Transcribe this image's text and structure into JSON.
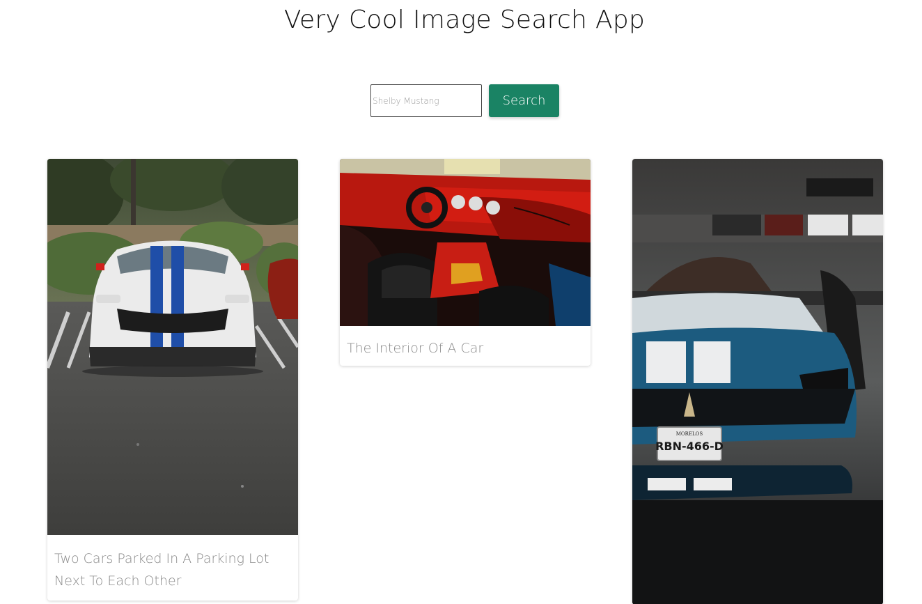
{
  "header": {
    "title": "Very Cool Image Search App"
  },
  "search": {
    "placeholder": "Shelby Mustang",
    "value": "",
    "button_label": "Search"
  },
  "results": [
    {
      "caption": "Two Cars Parked In A Parking Lot Next To Each Other",
      "plate": ""
    },
    {
      "caption": "The Interior Of A Car",
      "plate": ""
    },
    {
      "caption": "",
      "plate": "RBN-466-D",
      "plate_top": "MORELOS"
    }
  ],
  "colors": {
    "accent": "#1a8364",
    "caption_text": "#8a8a8a",
    "title_text": "#111111"
  }
}
